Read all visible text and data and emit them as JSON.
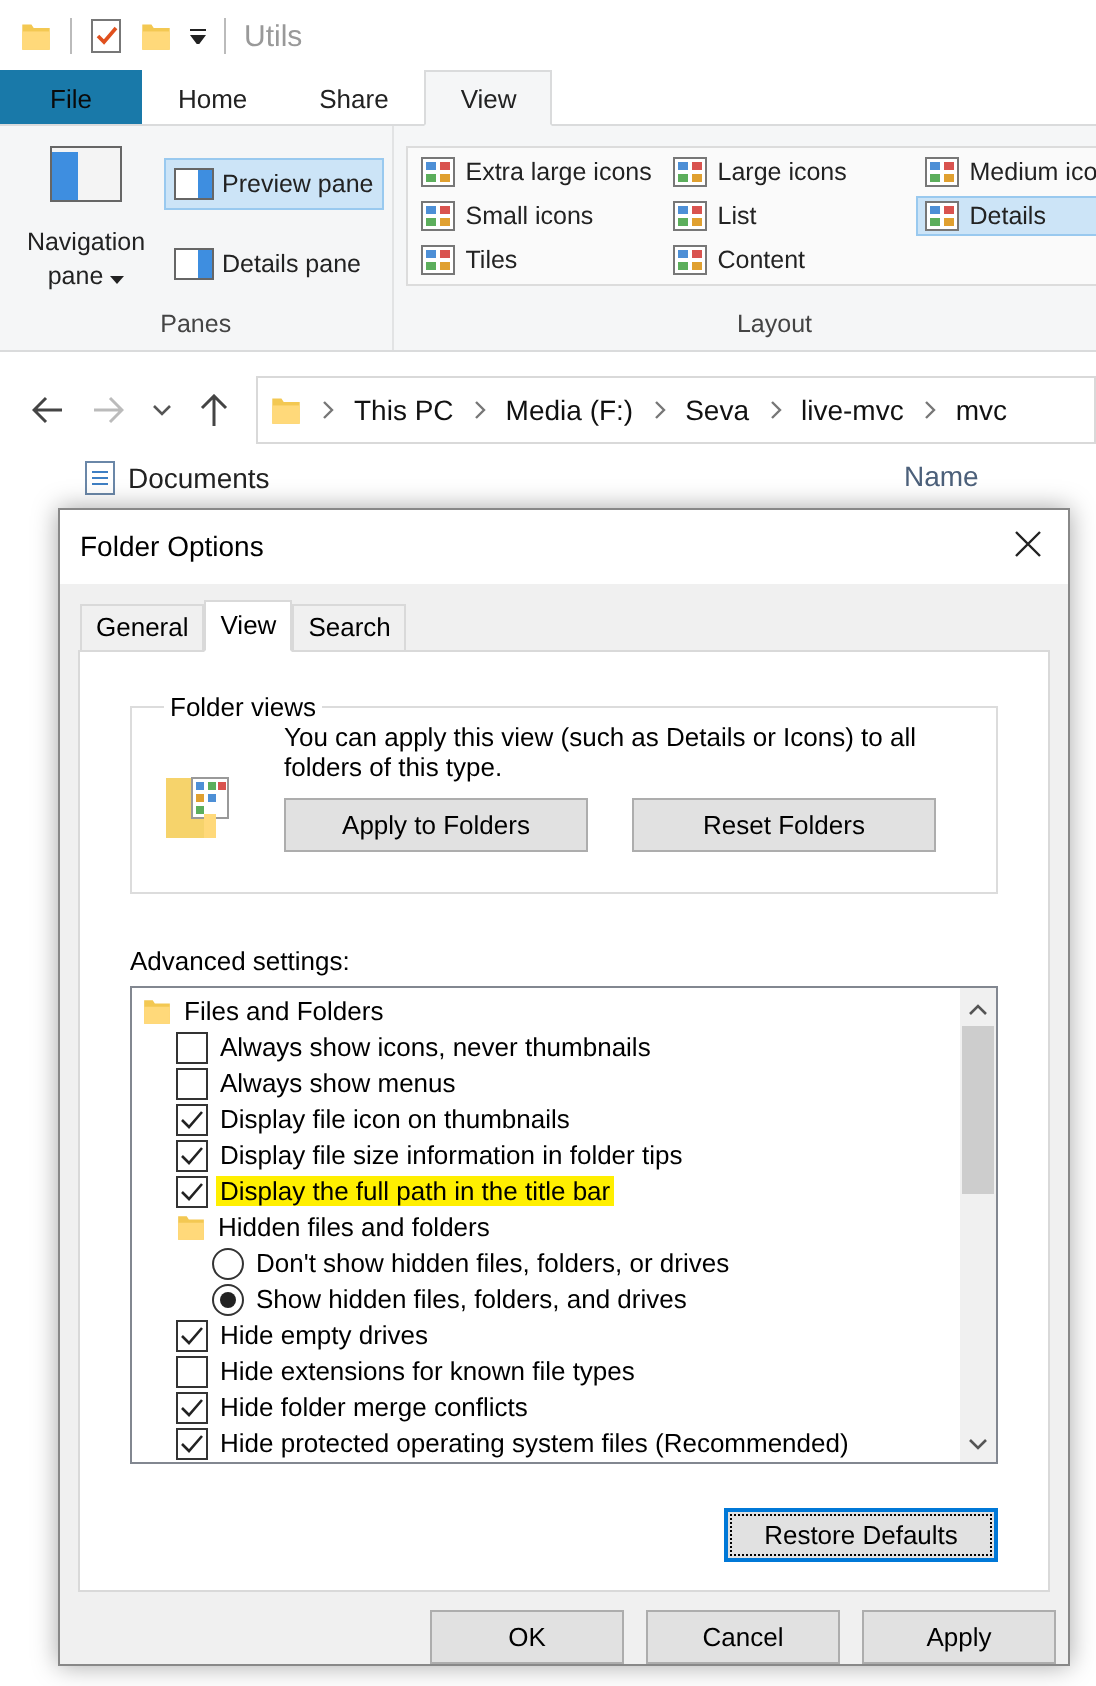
{
  "title_bar": {
    "title": "Utils"
  },
  "ribbon": {
    "tabs": [
      {
        "label": "File",
        "kind": "file",
        "selected": false
      },
      {
        "label": "Home",
        "kind": "tab",
        "selected": false
      },
      {
        "label": "Share",
        "kind": "tab",
        "selected": false
      },
      {
        "label": "View",
        "kind": "tab",
        "selected": true
      }
    ],
    "panes": {
      "label": "Panes",
      "navigation": "Navigation pane",
      "buttons": [
        {
          "label": "Preview pane",
          "selected": true
        },
        {
          "label": "Details pane",
          "selected": false
        }
      ]
    },
    "layout": {
      "label": "Layout",
      "options": [
        {
          "label": "Extra large icons",
          "selected": false
        },
        {
          "label": "Large icons",
          "selected": false
        },
        {
          "label": "Medium ico",
          "selected": false
        },
        {
          "label": "Small icons",
          "selected": false
        },
        {
          "label": "List",
          "selected": false
        },
        {
          "label": "Details",
          "selected": true
        },
        {
          "label": "Tiles",
          "selected": false
        },
        {
          "label": "Content",
          "selected": false
        }
      ]
    }
  },
  "address_bar": {
    "crumbs": [
      "This PC",
      "Media (F:)",
      "Seva",
      "live-mvc",
      "mvc"
    ]
  },
  "navigation_pane": {
    "items": [
      "Documents"
    ]
  },
  "file_list": {
    "column": "Name"
  },
  "dialog": {
    "title": "Folder Options",
    "tabs": [
      {
        "label": "General",
        "selected": false
      },
      {
        "label": "View",
        "selected": true
      },
      {
        "label": "Search",
        "selected": false
      }
    ],
    "folder_views": {
      "title": "Folder views",
      "text": "You can apply this view (such as Details or Icons) to all folders of this type.",
      "buttons": [
        "Apply to Folders",
        "Reset Folders"
      ]
    },
    "advanced_label": "Advanced settings:",
    "settings": [
      {
        "kind": "folder",
        "label": "Files and Folders",
        "children": [
          {
            "kind": "checkbox",
            "label": "Always show icons, never thumbnails",
            "checked": false,
            "highlighted": false
          },
          {
            "kind": "checkbox",
            "label": "Always show menus",
            "checked": false,
            "highlighted": false
          },
          {
            "kind": "checkbox",
            "label": "Display file icon on thumbnails",
            "checked": true,
            "highlighted": false
          },
          {
            "kind": "checkbox",
            "label": "Display file size information in folder tips",
            "checked": true,
            "highlighted": false
          },
          {
            "kind": "checkbox",
            "label": "Display the full path in the title bar",
            "checked": true,
            "highlighted": true
          },
          {
            "kind": "folder",
            "label": "Hidden files and folders",
            "children": [
              {
                "kind": "radio",
                "label": "Don't show hidden files, folders, or drives",
                "selected": false
              },
              {
                "kind": "radio",
                "label": "Show hidden files, folders, and drives",
                "selected": true
              }
            ]
          },
          {
            "kind": "checkbox",
            "label": "Hide empty drives",
            "checked": true,
            "highlighted": false
          },
          {
            "kind": "checkbox",
            "label": "Hide extensions for known file types",
            "checked": false,
            "highlighted": false
          },
          {
            "kind": "checkbox",
            "label": "Hide folder merge conflicts",
            "checked": true,
            "highlighted": false
          },
          {
            "kind": "checkbox",
            "label": "Hide protected operating system files (Recommended)",
            "checked": true,
            "highlighted": false
          }
        ]
      }
    ],
    "restore_button": {
      "label": "Restore Defaults",
      "focused": true
    },
    "buttons": [
      "OK",
      "Cancel",
      "Apply"
    ]
  }
}
